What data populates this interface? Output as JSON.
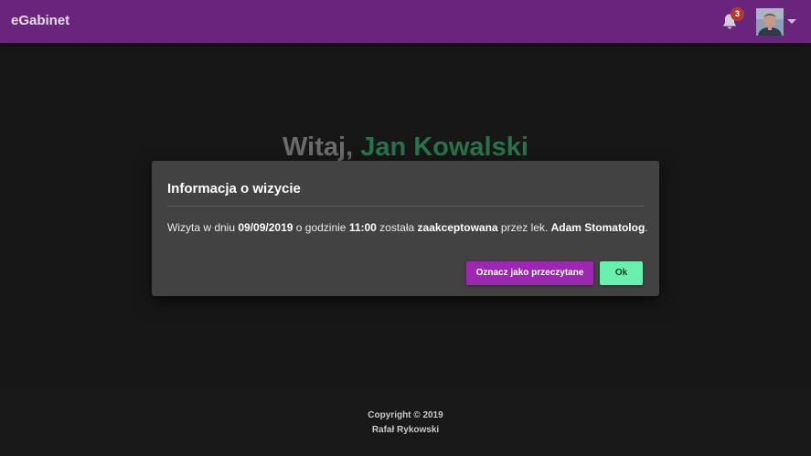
{
  "navbar": {
    "brand": "eGabinet",
    "notification_count": "3",
    "bell_icon": "bell-icon",
    "avatar_icon": "user-avatar",
    "dropdown_icon": "caret-down-icon",
    "background_color": "#69247b"
  },
  "welcome": {
    "greeting": "Witaj, ",
    "user_name": "Jan Kowalski"
  },
  "modal": {
    "title": "Informacja o wizycie",
    "body": {
      "part1": "Wizyta w dniu ",
      "date": "09/09/2019",
      "part2": " o godzinie ",
      "time": "11:00",
      "part3": " została ",
      "status": "zaakceptowana",
      "part4": " przez lek. ",
      "doctor": "Adam Stomatolog",
      "part5": "."
    },
    "mark_read_label": "Oznacz jako przeczytane",
    "ok_label": "Ok",
    "mark_read_color": "#9c27b0",
    "ok_color": "#69f0ae"
  },
  "footer": {
    "copyright": "Copyright © 2019",
    "author": "Rafał Rykowski"
  }
}
